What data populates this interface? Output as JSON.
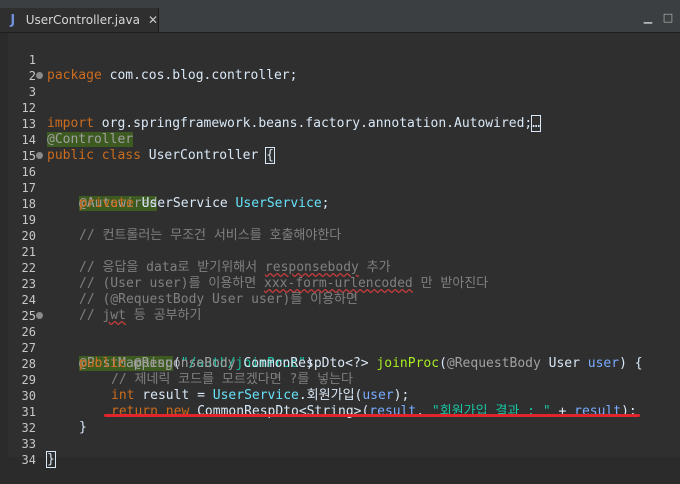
{
  "tab": {
    "title": "UserController.java",
    "close": "✕"
  },
  "lines": {
    "l1": {
      "num": "1",
      "kw": "package",
      "rest": " com.cos.blog.controller;"
    },
    "l2": {
      "num": "2"
    },
    "l3": {
      "num": "3",
      "kw": "import",
      "rest": " org.springframework.beans.factory.annotation.Autowired;",
      "box": "…"
    },
    "l12": {
      "num": "12"
    },
    "l13": {
      "num": "13",
      "ann": "@Controller"
    },
    "l14": {
      "num": "14",
      "kw": "public class",
      "rest": " UserController ",
      "brace": "{"
    },
    "l15": {
      "num": "15"
    },
    "l16": {
      "num": "16",
      "ann": "@Autowired"
    },
    "l17": {
      "num": "17",
      "kw": "private",
      "type": " UserService ",
      "field": "UserService",
      "end": ";"
    },
    "l18": {
      "num": "18"
    },
    "l19": {
      "num": "19",
      "comment": "// 컨트롤러는 무조건 서비스를 호출해야한다"
    },
    "l20": {
      "num": "20"
    },
    "l21": {
      "num": "21",
      "c1": "// 응답을 data로 받기위해서 ",
      "c1u": "responsebody",
      "c1e": " 추가"
    },
    "l22": {
      "num": "22",
      "c1": "// (User user)를 이용하면 ",
      "c1u": "xxx-form-urlencoded",
      "c1e": " 만 받아진다"
    },
    "l23": {
      "num": "23",
      "comment": "// (@RequestBody User user)를 이용하면"
    },
    "l24": {
      "num": "24",
      "c1": "// ",
      "c1u": "jwt",
      "c1e": " 등 공부하기"
    },
    "l25": {
      "num": "25"
    },
    "l26": {
      "num": "26",
      "ann": "@PostMapping",
      "open": "(",
      "str": "\"/auth/joinProc\"",
      "close": ")"
    },
    "l27": {
      "num": "27",
      "kw": "public",
      "ann": " @ResponseBody",
      "type": " CommonRespDto<?> ",
      "mth": "joinProc",
      "p1": "(",
      "ann2": "@RequestBody",
      "p2": " User ",
      "var": "user",
      "p3": ") {"
    },
    "l28": {
      "num": "28",
      "comment": "// 제네릭 코드를 모르겠다면 ?를 넣는다"
    },
    "l29": {
      "num": "29",
      "kw": "int",
      "p1": " result = ",
      "field": "UserService",
      "p2": ".회원가입(",
      "var": "user",
      "p3": ");"
    },
    "l30": {
      "num": "30",
      "kw": "return new",
      "p1": " CommonRespDto<String>(",
      "var": "result",
      "p2": ", ",
      "str": "\"회원가입 결과 : \"",
      "p3": " + ",
      "var2": "result",
      "p4": ");"
    },
    "l31": {
      "num": "31",
      "brace": "}"
    },
    "l32": {
      "num": "32"
    },
    "l33": {
      "num": "33",
      "brace": "}"
    },
    "l34": {
      "num": "34"
    }
  },
  "colors": {
    "annotation_highlight": "#3d5a21",
    "underline_mark": "#e0262a"
  }
}
